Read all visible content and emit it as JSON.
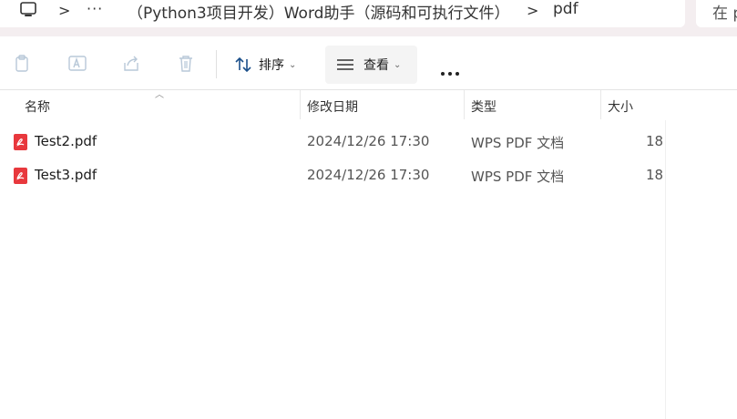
{
  "address_bar": {
    "more_label": "···",
    "path": [
      "（Python3项目开发）Word助手（源码和可执行文件）",
      "pdf"
    ],
    "separator": ">"
  },
  "search": {
    "placeholder": "在 p"
  },
  "toolbar": {
    "icons": [
      "copy-icon",
      "rename-icon",
      "share-icon",
      "delete-icon"
    ],
    "sort_label": "排序",
    "view_label": "查看"
  },
  "columns": {
    "name": "名称",
    "date": "修改日期",
    "type": "类型",
    "size": "大小"
  },
  "files": [
    {
      "name": "Test2.pdf",
      "date": "2024/12/26 17:30",
      "type": "WPS PDF 文档",
      "size": "18"
    },
    {
      "name": "Test3.pdf",
      "date": "2024/12/26 17:30",
      "type": "WPS PDF 文档",
      "size": "18"
    }
  ],
  "colors": {
    "accent_pdf": "#e8383d",
    "topbar_bg": "#f4eef0"
  }
}
